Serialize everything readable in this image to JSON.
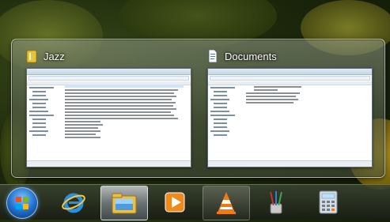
{
  "thumbnails": [
    {
      "title": "Jazz",
      "icon": "folder-icon"
    },
    {
      "title": "Documents",
      "icon": "document-icon"
    }
  ],
  "taskbar": {
    "start_icon": "windows-start-orb-icon",
    "pinned": [
      {
        "name": "internet-explorer-icon"
      },
      {
        "name": "windows-explorer-icon",
        "active": true
      },
      {
        "name": "media-player-icon"
      },
      {
        "name": "vlc-cone-icon"
      },
      {
        "name": "paint-brushes-icon"
      },
      {
        "name": "calculator-icon"
      }
    ]
  }
}
